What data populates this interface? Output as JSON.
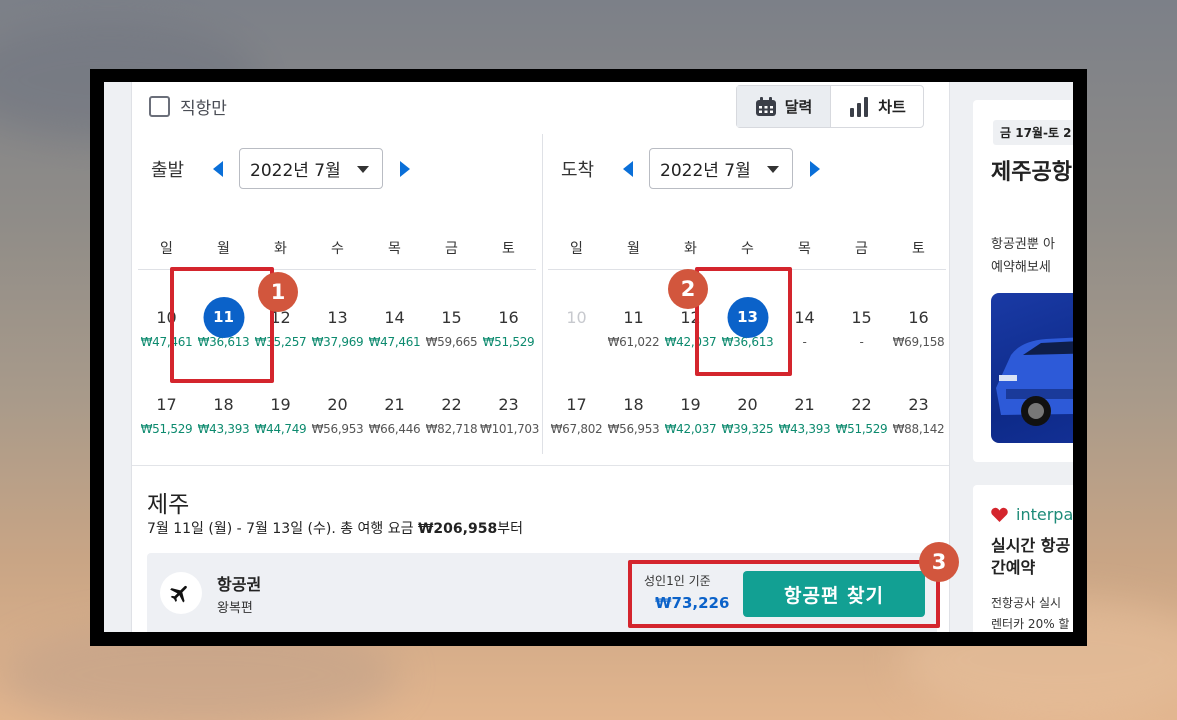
{
  "filters": {
    "direct_only_label": "직항만"
  },
  "view_toggle": {
    "calendar_label": "달력",
    "chart_label": "차트"
  },
  "departure": {
    "label": "출발",
    "month": "2022년 7월",
    "weekdays": [
      "일",
      "월",
      "화",
      "수",
      "목",
      "금",
      "토"
    ],
    "weeks": [
      [
        {
          "day": "10",
          "price": "₩47,461",
          "tone": "green"
        },
        {
          "day": "11",
          "price": "₩36,613",
          "tone": "green",
          "selected": true
        },
        {
          "day": "12",
          "price": "₩35,257",
          "tone": "green"
        },
        {
          "day": "13",
          "price": "₩37,969",
          "tone": "green"
        },
        {
          "day": "14",
          "price": "₩47,461",
          "tone": "green"
        },
        {
          "day": "15",
          "price": "₩59,665",
          "tone": "dim"
        },
        {
          "day": "16",
          "price": "₩51,529",
          "tone": "green"
        }
      ],
      [
        {
          "day": "17",
          "price": "₩51,529",
          "tone": "green"
        },
        {
          "day": "18",
          "price": "₩43,393",
          "tone": "green"
        },
        {
          "day": "19",
          "price": "₩44,749",
          "tone": "green"
        },
        {
          "day": "20",
          "price": "₩56,953",
          "tone": "dim"
        },
        {
          "day": "21",
          "price": "₩66,446",
          "tone": "dim"
        },
        {
          "day": "22",
          "price": "₩82,718",
          "tone": "dim"
        },
        {
          "day": "23",
          "price": "₩101,703",
          "tone": "dim"
        }
      ]
    ]
  },
  "arrival": {
    "label": "도착",
    "month": "2022년 7월",
    "weekdays": [
      "일",
      "월",
      "화",
      "수",
      "목",
      "금",
      "토"
    ],
    "weeks": [
      [
        {
          "day": "10",
          "price": "",
          "tone": "muted"
        },
        {
          "day": "11",
          "price": "₩61,022",
          "tone": "dim"
        },
        {
          "day": "12",
          "price": "₩42,037",
          "tone": "green"
        },
        {
          "day": "13",
          "price": "₩36,613",
          "tone": "green",
          "selected": true
        },
        {
          "day": "14",
          "price": "-",
          "tone": "dim"
        },
        {
          "day": "15",
          "price": "-",
          "tone": "dim"
        },
        {
          "day": "16",
          "price": "₩69,158",
          "tone": "dim"
        }
      ],
      [
        {
          "day": "17",
          "price": "₩67,802",
          "tone": "dim"
        },
        {
          "day": "18",
          "price": "₩56,953",
          "tone": "dim"
        },
        {
          "day": "19",
          "price": "₩42,037",
          "tone": "green"
        },
        {
          "day": "20",
          "price": "₩39,325",
          "tone": "green"
        },
        {
          "day": "21",
          "price": "₩43,393",
          "tone": "green"
        },
        {
          "day": "22",
          "price": "₩51,529",
          "tone": "green"
        },
        {
          "day": "23",
          "price": "₩88,142",
          "tone": "dim"
        }
      ]
    ]
  },
  "summary": {
    "destination": "제주",
    "trip_text_prefix": "7월 11일 (월) - 7월 13일 (수). 총 여행 요금 ",
    "trip_total": "₩206,958",
    "trip_text_suffix": "부터"
  },
  "flight": {
    "title": "항공권",
    "subtitle": "왕복편",
    "adult_label": "성인1인 기준",
    "price": "₩73,226",
    "find_button": "항공편 찾기"
  },
  "annotations": {
    "badge_1": "1",
    "badge_2": "2",
    "badge_3": "3"
  },
  "sidebar": {
    "ad": {
      "date_chip": "금 17월-토 2",
      "title": "제주공항 기",
      "desc_line1": "항공권뿐 아",
      "desc_line2": "예약해보세"
    },
    "interpark": {
      "brand": "interpa",
      "title_line1": "실시간 항공",
      "title_line2": "간예약",
      "desc_line1": "전항공사 실시",
      "desc_line2": "렌터카 20% 할"
    }
  },
  "colors": {
    "accent_blue": "#0b62c9",
    "price_green": "#0c8a6e",
    "button_teal": "#12a093",
    "highlight_red": "#d4252d",
    "badge_orange": "#d2563d"
  }
}
